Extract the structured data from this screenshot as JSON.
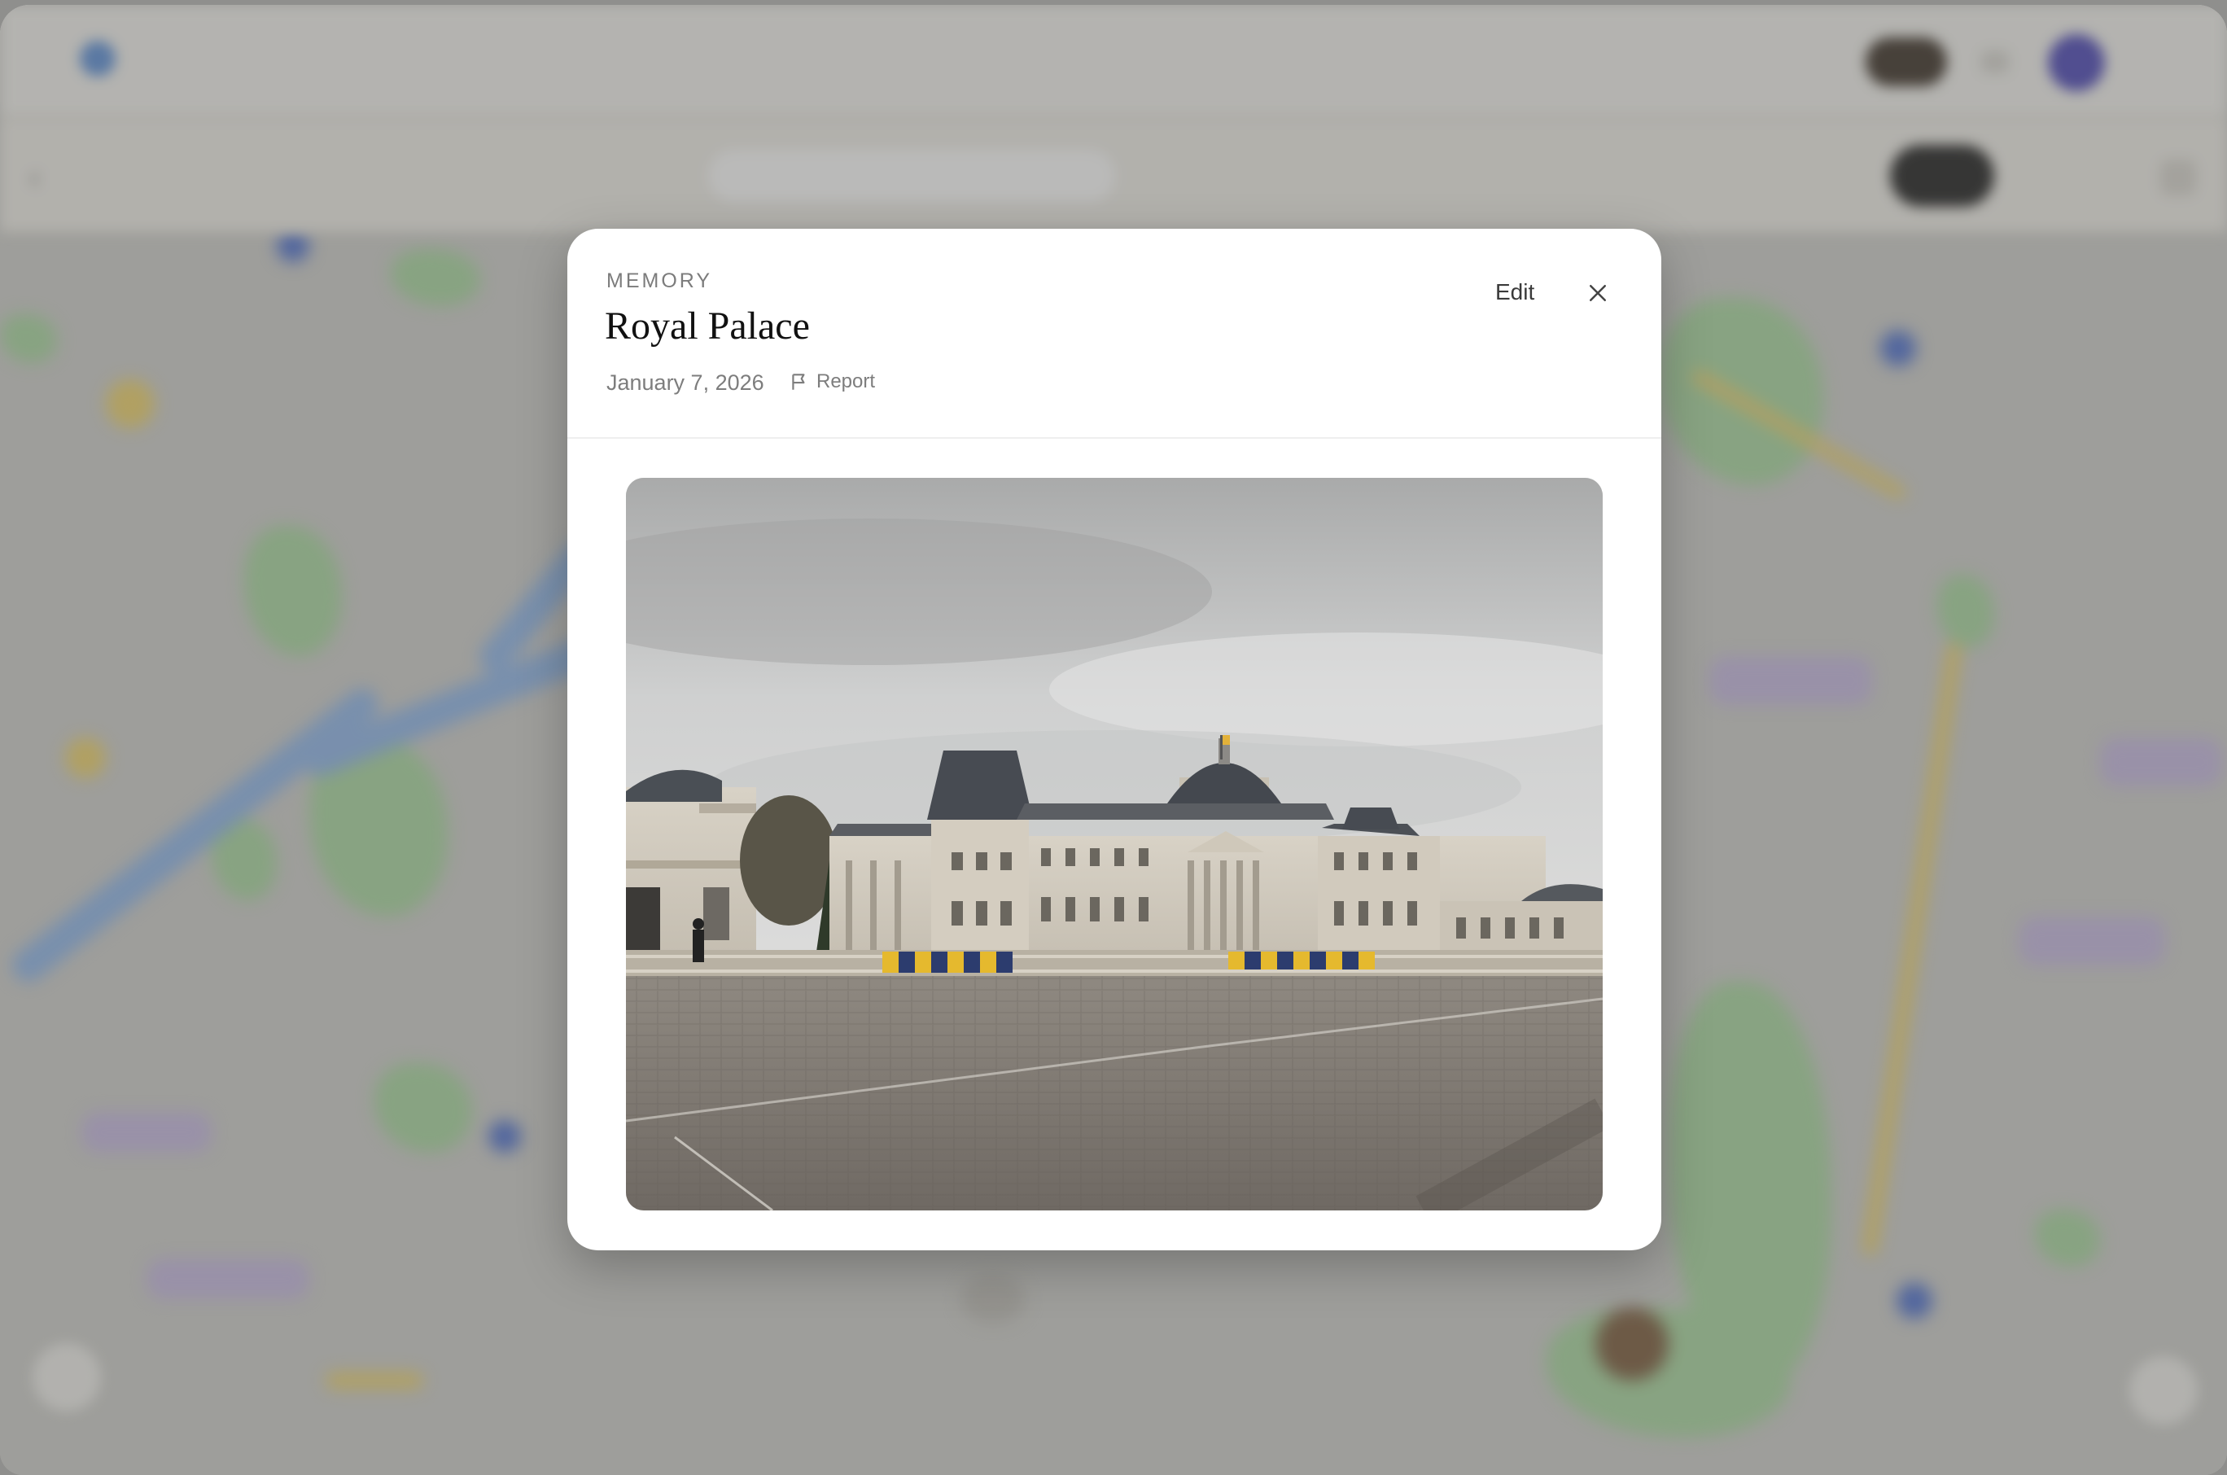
{
  "background_app": {
    "brand": "",
    "nav_links": [],
    "page_title": "",
    "page_caption": "",
    "search_placeholder": ""
  },
  "modal": {
    "eyebrow": "MEMORY",
    "title": "Royal Palace",
    "date": "January 7, 2026",
    "report_label": "Report",
    "edit_label": "Edit",
    "close_icon": "close-icon",
    "flag_icon": "flag-icon",
    "photo_subject": "royal-palace-photo"
  },
  "colors": {
    "modal_bg": "#ffffff",
    "scrim": "#8f8f8d",
    "title_text": "#111111",
    "muted_text": "#7d7d7d"
  }
}
